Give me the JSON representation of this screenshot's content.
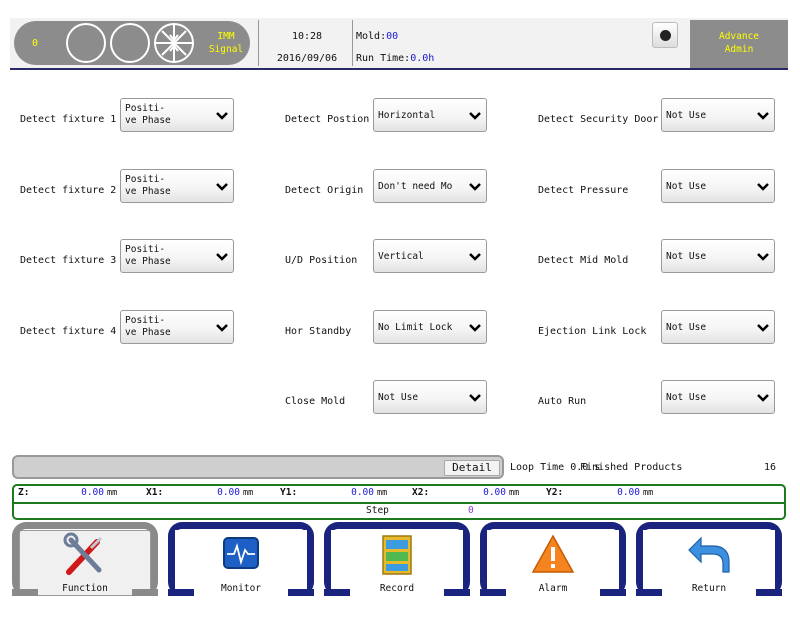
{
  "header": {
    "signal_count": "0",
    "signal_label_line1": "IMM",
    "signal_label_line2": "Signal",
    "time": "10:28",
    "date": "2016/09/06",
    "mold_label": "Mold:",
    "mold_value": "00",
    "runtime_label": "Run Time:",
    "runtime_value": "0.0h",
    "user_line1": "Advance",
    "user_line2": "Admin"
  },
  "col1": [
    {
      "label": "Detect fixture 1",
      "value": "Positi-\nve Phase"
    },
    {
      "label": "Detect fixture 2",
      "value": "Positi-\nve Phase"
    },
    {
      "label": "Detect fixture 3",
      "value": "Positi-\nve Phase"
    },
    {
      "label": "Detect fixture 4",
      "value": "Positi-\nve Phase"
    }
  ],
  "col2": [
    {
      "label": "Detect Postion",
      "value": "Horizontal"
    },
    {
      "label": "Detect Origin",
      "value": "Don't need Mo"
    },
    {
      "label": "U/D Position",
      "value": "Vertical"
    },
    {
      "label": "Hor Standby",
      "value": "No Limit Lock"
    },
    {
      "label": "Close Mold",
      "value": "Not Use"
    }
  ],
  "col3": [
    {
      "label": "Detect Security Door",
      "value": "Not Use"
    },
    {
      "label": "Detect Pressure",
      "value": "Not Use"
    },
    {
      "label": "Detect Mid Mold",
      "value": "Not Use"
    },
    {
      "label": "Ejection Link Lock",
      "value": "Not Use"
    },
    {
      "label": "Auto Run",
      "value": "Not Use"
    }
  ],
  "loop": {
    "detail_label": "Detail",
    "loop_text": "Loop Time  0.0 s",
    "finished_label": "Finished Products",
    "finished_value": "16"
  },
  "coords": {
    "axes": [
      {
        "name": "Z:",
        "value": "0.00",
        "unit": "mm"
      },
      {
        "name": "X1:",
        "value": "0.00",
        "unit": "mm"
      },
      {
        "name": "Y1:",
        "value": "0.00",
        "unit": "mm"
      },
      {
        "name": "X2:",
        "value": "0.00",
        "unit": "mm"
      },
      {
        "name": "Y2:",
        "value": "0.00",
        "unit": "mm"
      }
    ],
    "step_label": "Step",
    "step_value": "0"
  },
  "nav": [
    {
      "label": "Function",
      "icon": "function-tools-icon",
      "active": true
    },
    {
      "label": "Monitor",
      "icon": "monitor-icon",
      "active": false
    },
    {
      "label": "Record",
      "icon": "record-cabinet-icon",
      "active": false
    },
    {
      "label": "Alarm",
      "icon": "alarm-warning-icon",
      "active": false
    },
    {
      "label": "Return",
      "icon": "return-arrow-icon",
      "active": false
    }
  ],
  "colors": {
    "accent_blue": "#1a237e",
    "signal_yellow": "#ffff00",
    "status_green": "#1d7a1d"
  }
}
